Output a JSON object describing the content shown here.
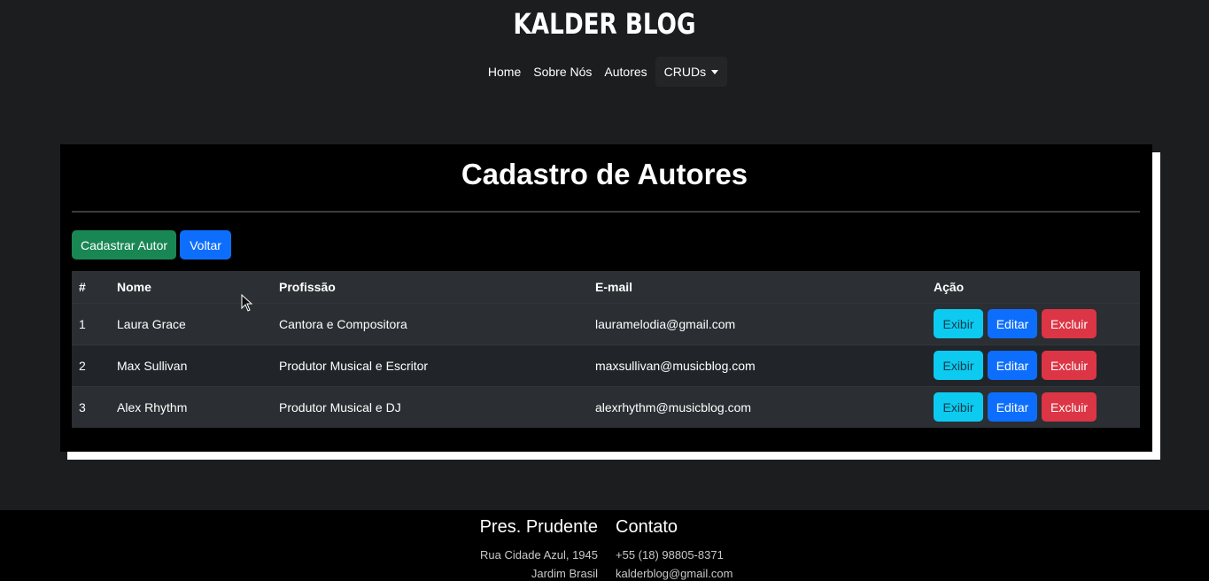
{
  "header": {
    "brand": "KALDER BLOG",
    "nav": [
      "Home",
      "Sobre Nós",
      "Autores"
    ],
    "dropdown": "CRUDs"
  },
  "main": {
    "title": "Cadastro de Autores",
    "buttons": {
      "create": "Cadastrar Autor",
      "back": "Voltar"
    },
    "table": {
      "headers": [
        "#",
        "Nome",
        "Profissão",
        "E-mail",
        "Ação"
      ],
      "rows": [
        {
          "id": "1",
          "nome": "Laura Grace",
          "profissao": "Cantora e Compositora",
          "email": "lauramelodia@gmail.com"
        },
        {
          "id": "2",
          "nome": "Max Sullivan",
          "profissao": "Produtor Musical e Escritor",
          "email": "maxsullivan@musicblog.com"
        },
        {
          "id": "3",
          "nome": "Alex Rhythm",
          "profissao": "Produtor Musical e DJ",
          "email": "alexrhythm@musicblog.com"
        }
      ],
      "actions": {
        "view": "Exibir",
        "edit": "Editar",
        "delete": "Excluir"
      }
    }
  },
  "footer": {
    "left": {
      "title": "Pres. Prudente",
      "line1": "Rua Cidade Azul, 1945",
      "line2": "Jardim Brasil"
    },
    "right": {
      "title": "Contato",
      "line1": "+55 (18) 98805-8371",
      "line2": "kalderblog@gmail.com"
    }
  },
  "colors": {
    "background": "#1b1d1f",
    "card": "#000000",
    "green": "#198754",
    "blue": "#0d6efd",
    "cyan": "#0dcaf0",
    "red": "#dc3545"
  }
}
